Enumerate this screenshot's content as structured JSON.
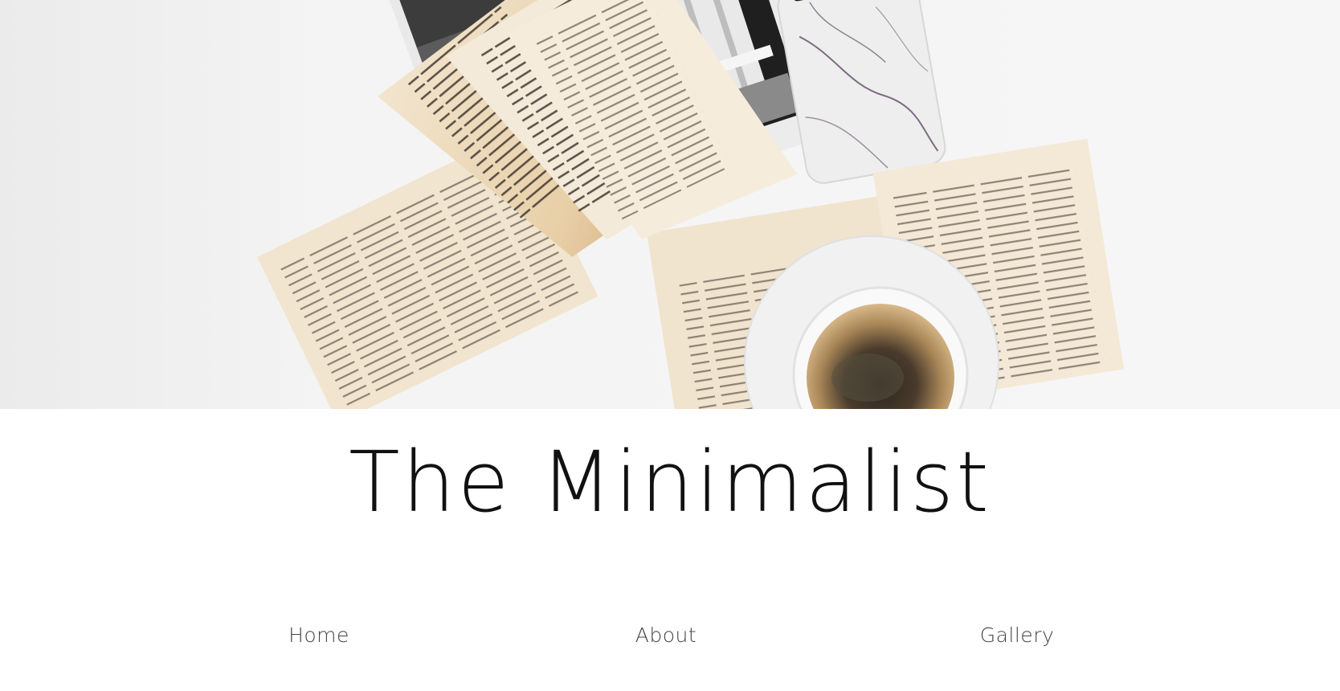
{
  "hero": {
    "image_name": "books-coffee-flatlay-image",
    "bg_color": "#f3f3f3",
    "paper_color": "#efe3cf",
    "text_color": "#3a3028"
  },
  "header": {
    "title": "The Minimalist"
  },
  "nav": {
    "items": [
      {
        "label": "Home"
      },
      {
        "label": "About"
      },
      {
        "label": "Gallery"
      }
    ]
  }
}
